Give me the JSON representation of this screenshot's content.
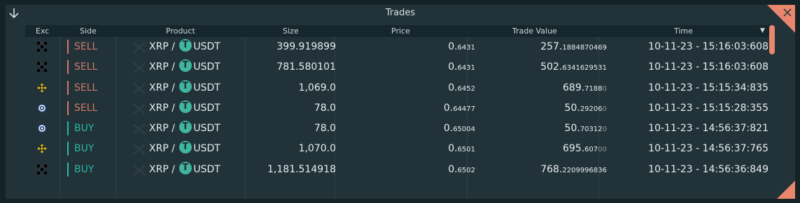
{
  "panel": {
    "title": "Trades"
  },
  "columns": {
    "exc": "Exc",
    "side": "Side",
    "product": "Product",
    "size": "Size",
    "price": "Price",
    "trade_value": "Trade Value",
    "time": "Time",
    "time_sort_icon": "▼"
  },
  "colors": {
    "sell": "#d1796a",
    "buy": "#27b8a5",
    "accent": "#e8876d"
  },
  "rows": [
    {
      "exchange_icon": "okx-icon",
      "side": "SELL",
      "base": "XRP",
      "sep": "/",
      "quote": "USDT",
      "size": "399.919899",
      "price_int": "0.",
      "price_dec": "6431",
      "tv_int": "257.",
      "tv_dec": "1884870469",
      "tv_dim": "",
      "time": "10-11-23 - 15:16:03:608"
    },
    {
      "exchange_icon": "okx-icon",
      "side": "SELL",
      "base": "XRP",
      "sep": "/",
      "quote": "USDT",
      "size": "781.580101",
      "price_int": "0.",
      "price_dec": "6431",
      "tv_int": "502.",
      "tv_dec": "6341629531",
      "tv_dim": "",
      "time": "10-11-23 - 15:16:03:608"
    },
    {
      "exchange_icon": "binance-icon",
      "side": "SELL",
      "base": "XRP",
      "sep": "/",
      "quote": "USDT",
      "size": "1,069.0",
      "price_int": "0.",
      "price_dec": "6452",
      "tv_int": "689.",
      "tv_dec": "7188",
      "tv_dim": "0",
      "time": "10-11-23 - 15:15:34:835"
    },
    {
      "exchange_icon": "cryptocom-icon",
      "side": "SELL",
      "base": "XRP",
      "sep": "/",
      "quote": "USDT",
      "size": "78.0",
      "price_int": "0.",
      "price_dec": "64477",
      "tv_int": "50.",
      "tv_dec": "29206",
      "tv_dim": "0",
      "time": "10-11-23 - 15:15:28:355"
    },
    {
      "exchange_icon": "cryptocom-icon",
      "side": "BUY",
      "base": "XRP",
      "sep": "/",
      "quote": "USDT",
      "size": "78.0",
      "price_int": "0.",
      "price_dec": "65004",
      "tv_int": "50.",
      "tv_dec": "70312",
      "tv_dim": "0",
      "time": "10-11-23 - 14:56:37:821"
    },
    {
      "exchange_icon": "binance-icon",
      "side": "BUY",
      "base": "XRP",
      "sep": "/",
      "quote": "USDT",
      "size": "1,070.0",
      "price_int": "0.",
      "price_dec": "6501",
      "tv_int": "695.",
      "tv_dec": "607",
      "tv_dim": "00",
      "time": "10-11-23 - 14:56:37:765"
    },
    {
      "exchange_icon": "okx-icon",
      "side": "BUY",
      "base": "XRP",
      "sep": "/",
      "quote": "USDT",
      "size": "1,181.514918",
      "price_int": "0.",
      "price_dec": "6502",
      "tv_int": "768.",
      "tv_dec": "2209996836",
      "tv_dim": "",
      "time": "10-11-23 - 14:56:36:849"
    }
  ]
}
